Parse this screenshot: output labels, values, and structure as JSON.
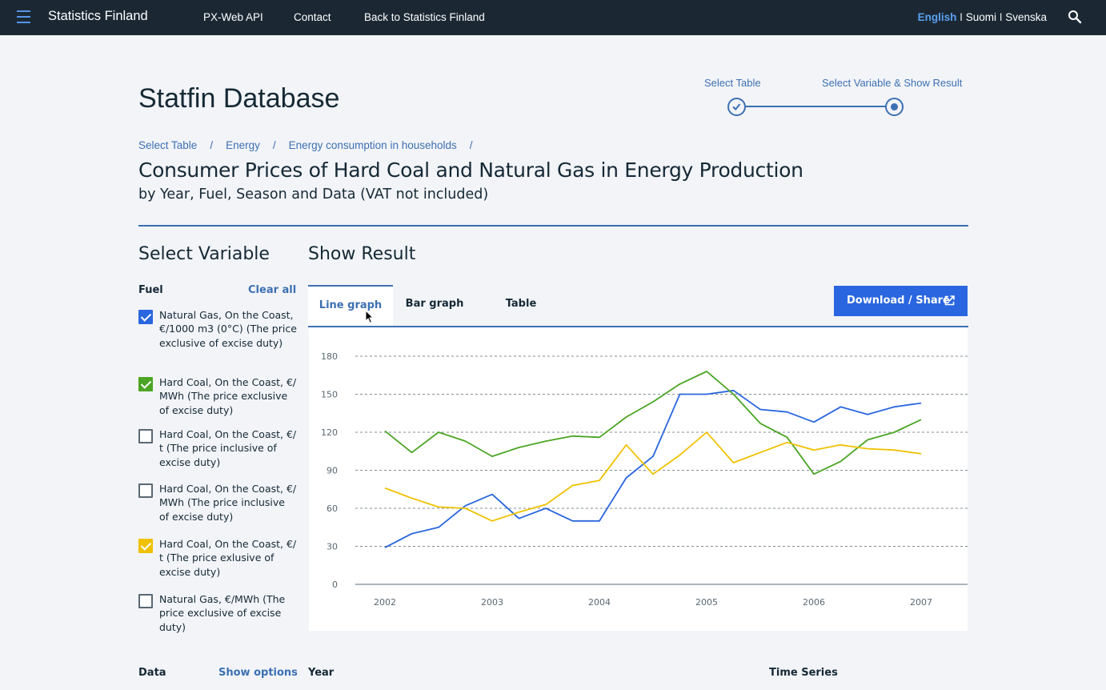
{
  "topbar": {
    "brand": "Statistics Finland",
    "nav": [
      "PX-Web API",
      "Contact",
      "Back to Statistics Finland"
    ],
    "lang_active": "English",
    "lang_sep": " I ",
    "lang_others": [
      "Suomi",
      "Svenska"
    ],
    "menu_icon": "hamburger-icon",
    "search_icon": "search-icon"
  },
  "header": {
    "title": "Statfin Database",
    "steps": [
      "Select Table",
      "Select Variable & Show Result"
    ]
  },
  "breadcrumb": [
    "Select Table",
    "Energy",
    "Energy consumption in households"
  ],
  "table": {
    "title": "Consumer Prices of Hard Coal and Natural Gas in Energy Production",
    "subtitle": "by Year, Fuel, Season and Data (VAT not included)"
  },
  "select_variable": {
    "heading": "Select Variable",
    "fuel_label": "Fuel",
    "clear_all": "Clear all",
    "options": [
      {
        "label": "Natural Gas, On the Coast, €/1000 m3 (0°C)  (The price exclusive of excise duty)",
        "checked": true,
        "color": "#2a66df"
      },
      {
        "label": "Hard Coal, On the Coast, €/ MWh (The price exclusive of excise duty)",
        "checked": true,
        "color": "#4ba524"
      },
      {
        "label": "Hard Coal, On the Coast, €/ t (The price inclusive of excise duty)",
        "checked": false,
        "color": ""
      },
      {
        "label": "Hard Coal, On the Coast, €/ MWh (The price inclusive of excise duty)",
        "checked": false,
        "color": ""
      },
      {
        "label": "Hard Coal, On the Coast, €/ t (The price exlusive of excise duty)",
        "checked": true,
        "color": "#efc100"
      },
      {
        "label": "Natural Gas, €/MWh  (The price exclusive of excise duty)",
        "checked": false,
        "color": ""
      }
    ],
    "data_label": "Data",
    "show_options": "Show options"
  },
  "show_result": {
    "heading": "Show Result",
    "tabs": [
      "Line graph",
      "Bar graph",
      "Table"
    ],
    "active_tab": "Line graph",
    "download_label": "Download / Share",
    "year_label": "Year",
    "time_series_label": "Time Series"
  },
  "chart_data": {
    "type": "line",
    "x_tick_labels": [
      "2002",
      "2003",
      "2004",
      "2005",
      "2006",
      "2007"
    ],
    "x_domain": [
      2002,
      2007
    ],
    "ylim": [
      0,
      180
    ],
    "y_ticks": [
      0,
      30,
      60,
      90,
      120,
      150,
      180
    ],
    "grid": true,
    "series": [
      {
        "color": "#2a66df",
        "x": [
          2002.0,
          2002.25,
          2002.5,
          2002.75,
          2003.0,
          2003.25,
          2003.5,
          2003.75,
          2004.0,
          2004.25,
          2004.5,
          2004.75,
          2005.0,
          2005.25,
          2005.5,
          2005.75,
          2006.0,
          2006.25,
          2006.5,
          2006.75,
          2007.0
        ],
        "values": [
          29,
          40,
          45,
          62,
          71,
          52,
          60,
          50,
          50,
          84,
          101,
          150,
          150,
          153,
          138,
          136,
          128,
          140,
          134,
          140,
          143
        ]
      },
      {
        "color": "#4ba524",
        "x": [
          2002.0,
          2002.25,
          2002.5,
          2002.75,
          2003.0,
          2003.25,
          2003.5,
          2003.75,
          2004.0,
          2004.25,
          2004.5,
          2004.75,
          2005.0,
          2005.25,
          2005.5,
          2005.75,
          2006.0,
          2006.25,
          2006.5,
          2006.75,
          2007.0
        ],
        "values": [
          121,
          104,
          120,
          113,
          101,
          108,
          113,
          117,
          116,
          132,
          144,
          158,
          168,
          150,
          127,
          116,
          87,
          97,
          114,
          120,
          130
        ]
      },
      {
        "color": "#efc100",
        "x": [
          2002.0,
          2002.25,
          2002.5,
          2002.75,
          2003.0,
          2003.25,
          2003.5,
          2003.75,
          2004.0,
          2004.25,
          2004.5,
          2004.75,
          2005.0,
          2005.25,
          2005.5,
          2005.75,
          2006.0,
          2006.25,
          2006.5,
          2006.75,
          2007.0
        ],
        "values": [
          76,
          68,
          61,
          60,
          50,
          57,
          63,
          78,
          82,
          110,
          87,
          102,
          120,
          96,
          104,
          112,
          106,
          110,
          107,
          106,
          103
        ]
      }
    ]
  }
}
